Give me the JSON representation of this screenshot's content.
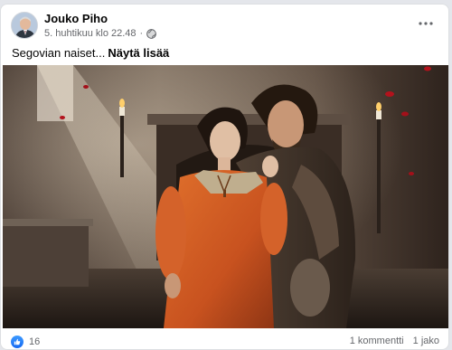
{
  "post": {
    "author": "Jouko Piho",
    "timestamp": "5. huhtikuu klo 22.48",
    "privacy_icon": "globe-icon",
    "caption": "Segovian naiset...",
    "see_more": "Näytä lisää",
    "reaction_icon": "like-icon",
    "reaction_count": "16",
    "comments": "1 kommentti",
    "shares": "1 jako"
  },
  "colors": {
    "accent": "#1877f2",
    "secondary_text": "#65676b",
    "dress": "#c8521f"
  }
}
